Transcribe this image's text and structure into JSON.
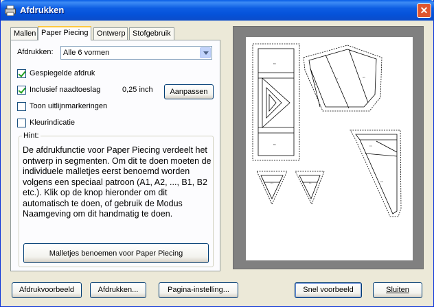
{
  "window": {
    "title": "Afdrukken",
    "close_glyph": "✕"
  },
  "tabs": [
    {
      "label": "Mallen",
      "active": false
    },
    {
      "label": "Paper Piecing",
      "active": true
    },
    {
      "label": "Ontwerp",
      "active": false
    },
    {
      "label": "Stofgebruik",
      "active": false
    }
  ],
  "panel": {
    "print_label": "Afdrukken:",
    "print_select": "Alle 6 vormen",
    "mirrored": {
      "label": "Gespiegelde afdruk",
      "checked": true
    },
    "seam": {
      "label": "Inclusief naadtoeslag",
      "checked": true,
      "value": "0,25 inch"
    },
    "adjust_button": "Aanpassen",
    "alignment": {
      "label": "Toon uitlijnmarkeringen",
      "checked": false
    },
    "color": {
      "label": "Kleurindicatie",
      "checked": false
    },
    "hint_legend": "Hint:",
    "hint_text": "De afdrukfunctie voor Paper Piecing verdeelt het ontwerp in segmenten. Om dit te doen moeten de individuele malletjes eerst benoemd worden volgens een speciaal patroon (A1, A2, ..., B1, B2 etc.). Klik op de knop hieronder om dit automatisch te doen, of gebruik de Modus Naamgeving om dit handmatig te doen.",
    "name_button": "Malletjes benoemen voor Paper Piecing"
  },
  "footer": {
    "preview_button": "Afdrukvoorbeeld",
    "print_button": "Afdrukken...",
    "page_setup_button": "Pagina-instelling...",
    "quick_preview_button": "Snel voorbeeld",
    "close_button": "Sluiten"
  },
  "icons": {
    "title": "printer-icon",
    "dropdown": "chevron-down-icon",
    "close": "close-icon"
  },
  "colors": {
    "titlebar": "#0552D9",
    "close": "#E0552F",
    "tab_highlight": "#FFC83C",
    "preview_bg": "#808080"
  }
}
